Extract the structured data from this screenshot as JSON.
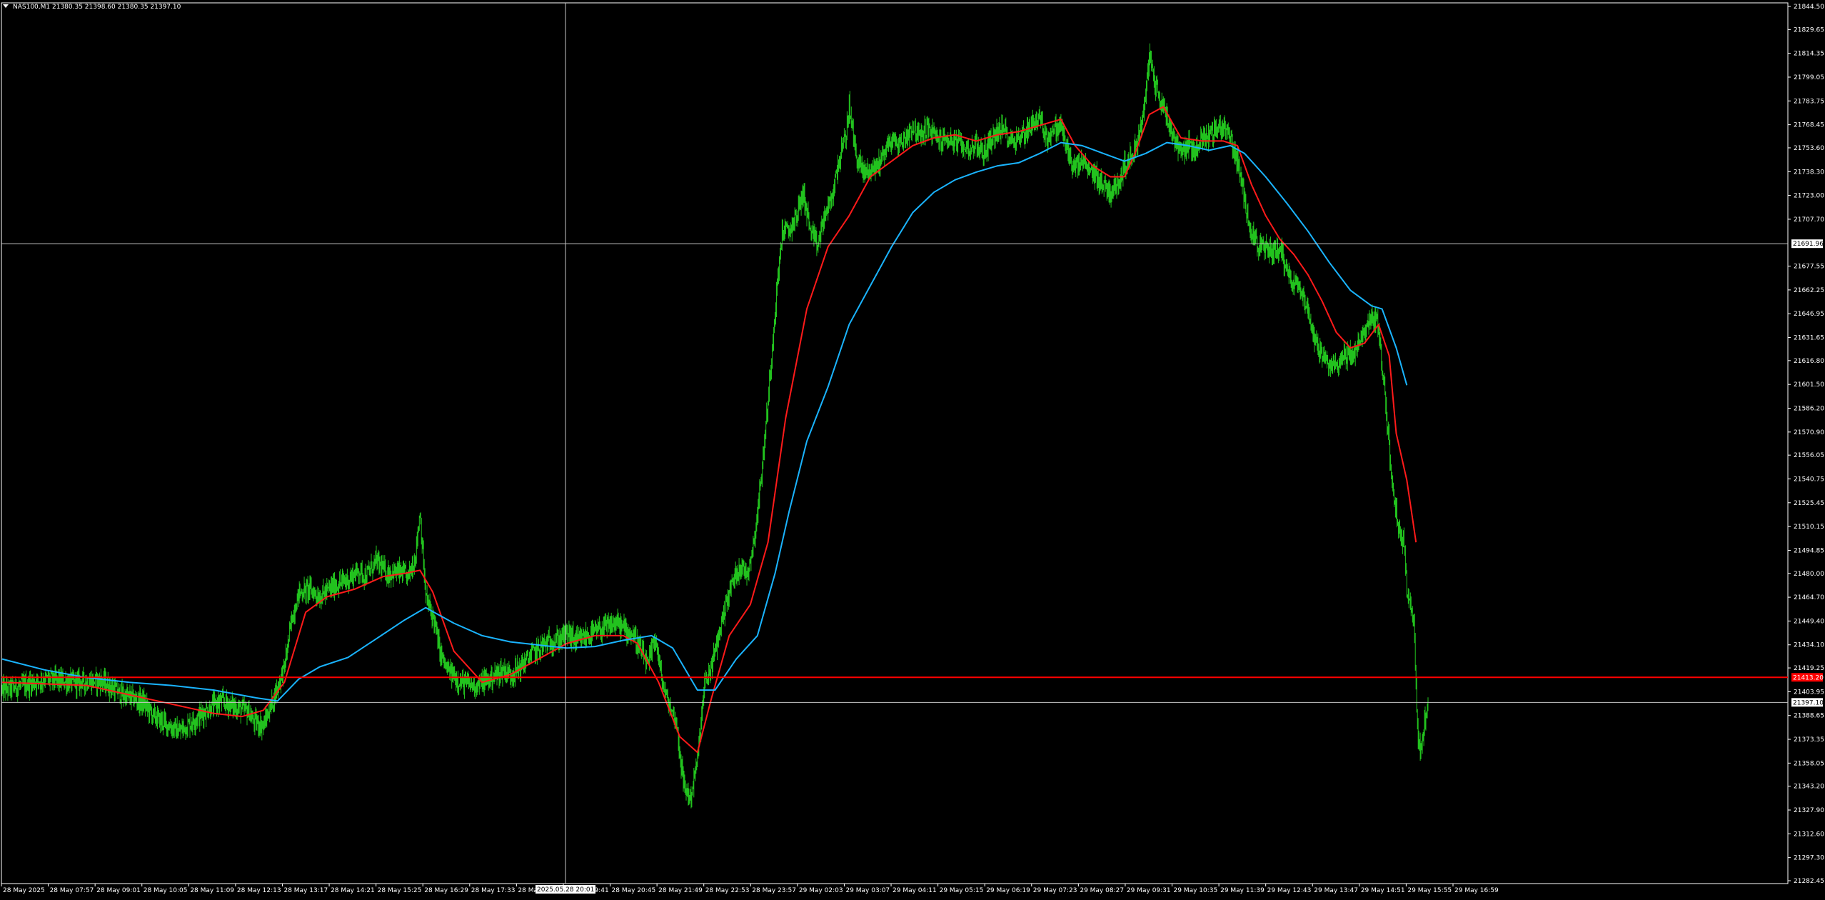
{
  "window": {
    "symbol_info": "NAS100,M1  21380.35 21398.60 21380.35 21397.10"
  },
  "colors": {
    "background": "#000000",
    "frame": "#ffffff",
    "axis_text": "#ffffff",
    "candles": "#22c21e",
    "wick": "#22c21e",
    "ma_fast": "#ff1a1a",
    "ma_slow": "#1ab4ff",
    "crosshair": "#c8c8c8",
    "hline_red": "#ff0000",
    "bid_line": "#c8c8c8"
  },
  "crosshair": {
    "price_label": "21691.96",
    "time_label": "2025.05.28 20:01"
  },
  "markers": {
    "red_line_label": "21413.20",
    "bid_label": "21397.10"
  },
  "chart_data": {
    "type": "line",
    "title": "NAS100,M1",
    "xlabel": "",
    "ylabel": "",
    "ylim": [
      21282.45,
      21844.5
    ],
    "grid": false,
    "y_ticks": [
      "21844.50",
      "21829.65",
      "21814.35",
      "21799.05",
      "21783.75",
      "21768.45",
      "21753.60",
      "21738.30",
      "21723.00",
      "21707.70",
      "21677.55",
      "21662.25",
      "21646.95",
      "21631.65",
      "21616.80",
      "21601.50",
      "21586.20",
      "21570.90",
      "21556.05",
      "21540.75",
      "21525.45",
      "21510.15",
      "21494.85",
      "21480.00",
      "21464.70",
      "21449.40",
      "21434.10",
      "21419.25",
      "21403.95",
      "21388.65",
      "21373.35",
      "21358.05",
      "21343.20",
      "21327.90",
      "21312.60",
      "21297.30",
      "21282.45"
    ],
    "x_ticks": [
      "28 May 2025",
      "28 May 07:57",
      "28 May 09:01",
      "28 May 10:05",
      "28 May 11:09",
      "28 May 12:13",
      "28 May 13:17",
      "28 May 14:21",
      "28 May 15:25",
      "28 May 16:29",
      "28 May 17:33",
      "28 May 18:37",
      "28 May 19:41",
      "28 May 20:45",
      "28 May 21:49",
      "28 May 22:53",
      "28 May 23:57",
      "29 May 02:03",
      "29 May 03:07",
      "29 May 04:11",
      "29 May 05:15",
      "29 May 06:19",
      "29 May 07:23",
      "29 May 08:27",
      "29 May 09:31",
      "29 May 10:35",
      "29 May 11:39",
      "29 May 12:43",
      "29 May 13:47",
      "29 May 14:51",
      "29 May 15:55",
      "29 May 16:59"
    ],
    "price_path": [
      [
        0,
        21405
      ],
      [
        30,
        21408
      ],
      [
        60,
        21412
      ],
      [
        100,
        21410
      ],
      [
        140,
        21411
      ],
      [
        170,
        21402
      ],
      [
        200,
        21397
      ],
      [
        215,
        21388
      ],
      [
        230,
        21384
      ],
      [
        250,
        21378
      ],
      [
        270,
        21385
      ],
      [
        290,
        21392
      ],
      [
        310,
        21398
      ],
      [
        330,
        21394
      ],
      [
        350,
        21391
      ],
      [
        355,
        21385
      ],
      [
        370,
        21382
      ],
      [
        385,
        21400
      ],
      [
        400,
        21420
      ],
      [
        410,
        21450
      ],
      [
        420,
        21467
      ],
      [
        435,
        21470
      ],
      [
        450,
        21465
      ],
      [
        470,
        21472
      ],
      [
        490,
        21476
      ],
      [
        505,
        21482
      ],
      [
        515,
        21478
      ],
      [
        530,
        21488
      ],
      [
        545,
        21480
      ],
      [
        560,
        21481
      ],
      [
        575,
        21478
      ],
      [
        585,
        21490
      ],
      [
        592,
        21520
      ],
      [
        600,
        21465
      ],
      [
        612,
        21450
      ],
      [
        620,
        21430
      ],
      [
        630,
        21418
      ],
      [
        650,
        21410
      ],
      [
        670,
        21408
      ],
      [
        690,
        21412
      ],
      [
        710,
        21418
      ],
      [
        720,
        21415
      ],
      [
        735,
        21420
      ],
      [
        750,
        21428
      ],
      [
        770,
        21435
      ],
      [
        790,
        21438
      ],
      [
        800,
        21442
      ],
      [
        815,
        21436
      ],
      [
        830,
        21440
      ],
      [
        850,
        21444
      ],
      [
        870,
        21448
      ],
      [
        880,
        21445
      ],
      [
        895,
        21440
      ],
      [
        905,
        21430
      ],
      [
        915,
        21420
      ],
      [
        925,
        21440
      ],
      [
        935,
        21410
      ],
      [
        945,
        21395
      ],
      [
        955,
        21385
      ],
      [
        965,
        21345
      ],
      [
        975,
        21335
      ],
      [
        985,
        21360
      ],
      [
        995,
        21408
      ],
      [
        1005,
        21420
      ],
      [
        1015,
        21440
      ],
      [
        1025,
        21460
      ],
      [
        1035,
        21475
      ],
      [
        1045,
        21485
      ],
      [
        1055,
        21480
      ],
      [
        1065,
        21500
      ],
      [
        1075,
        21540
      ],
      [
        1085,
        21590
      ],
      [
        1095,
        21650
      ],
      [
        1105,
        21700
      ],
      [
        1115,
        21700
      ],
      [
        1125,
        21710
      ],
      [
        1135,
        21725
      ],
      [
        1145,
        21700
      ],
      [
        1155,
        21690
      ],
      [
        1165,
        21710
      ],
      [
        1175,
        21720
      ],
      [
        1185,
        21745
      ],
      [
        1195,
        21760
      ],
      [
        1200,
        21780
      ],
      [
        1210,
        21748
      ],
      [
        1220,
        21738
      ],
      [
        1230,
        21740
      ],
      [
        1240,
        21742
      ],
      [
        1250,
        21752
      ],
      [
        1260,
        21758
      ],
      [
        1270,
        21756
      ],
      [
        1280,
        21760
      ],
      [
        1290,
        21768
      ],
      [
        1300,
        21760
      ],
      [
        1310,
        21767
      ],
      [
        1320,
        21762
      ],
      [
        1330,
        21758
      ],
      [
        1340,
        21760
      ],
      [
        1350,
        21757
      ],
      [
        1360,
        21755
      ],
      [
        1370,
        21753
      ],
      [
        1380,
        21756
      ],
      [
        1390,
        21750
      ],
      [
        1400,
        21758
      ],
      [
        1410,
        21764
      ],
      [
        1420,
        21765
      ],
      [
        1430,
        21758
      ],
      [
        1440,
        21760
      ],
      [
        1450,
        21764
      ],
      [
        1460,
        21770
      ],
      [
        1470,
        21772
      ],
      [
        1480,
        21760
      ],
      [
        1490,
        21765
      ],
      [
        1500,
        21768
      ],
      [
        1510,
        21750
      ],
      [
        1520,
        21740
      ],
      [
        1530,
        21745
      ],
      [
        1540,
        21738
      ],
      [
        1550,
        21736
      ],
      [
        1560,
        21730
      ],
      [
        1570,
        21725
      ],
      [
        1580,
        21730
      ],
      [
        1590,
        21742
      ],
      [
        1600,
        21748
      ],
      [
        1610,
        21760
      ],
      [
        1620,
        21785
      ],
      [
        1625,
        21815
      ],
      [
        1630,
        21800
      ],
      [
        1640,
        21785
      ],
      [
        1650,
        21775
      ],
      [
        1660,
        21760
      ],
      [
        1670,
        21752
      ],
      [
        1680,
        21755
      ],
      [
        1690,
        21752
      ],
      [
        1700,
        21760
      ],
      [
        1710,
        21762
      ],
      [
        1720,
        21765
      ],
      [
        1730,
        21768
      ],
      [
        1740,
        21760
      ],
      [
        1750,
        21745
      ],
      [
        1760,
        21720
      ],
      [
        1770,
        21700
      ],
      [
        1780,
        21690
      ],
      [
        1790,
        21688
      ],
      [
        1800,
        21687
      ],
      [
        1810,
        21690
      ],
      [
        1820,
        21675
      ],
      [
        1830,
        21667
      ],
      [
        1840,
        21665
      ],
      [
        1850,
        21648
      ],
      [
        1860,
        21630
      ],
      [
        1870,
        21620
      ],
      [
        1880,
        21612
      ],
      [
        1890,
        21615
      ],
      [
        1900,
        21620
      ],
      [
        1910,
        21620
      ],
      [
        1920,
        21625
      ],
      [
        1930,
        21635
      ],
      [
        1940,
        21645
      ],
      [
        1950,
        21640
      ],
      [
        1955,
        21610
      ],
      [
        1960,
        21590
      ],
      [
        1965,
        21560
      ],
      [
        1970,
        21535
      ],
      [
        1975,
        21520
      ],
      [
        1980,
        21505
      ],
      [
        1985,
        21500
      ],
      [
        1990,
        21470
      ],
      [
        1995,
        21465
      ],
      [
        2000,
        21450
      ],
      [
        2003,
        21410
      ],
      [
        2006,
        21370
      ],
      [
        2010,
        21365
      ],
      [
        2015,
        21385
      ],
      [
        2020,
        21397
      ]
    ],
    "series": [
      {
        "values": [
          [
            0,
            21410
          ],
          [
            60,
            21409
          ],
          [
            120,
            21408
          ],
          [
            180,
            21402
          ],
          [
            240,
            21396
          ],
          [
            300,
            21390
          ],
          [
            340,
            21388
          ],
          [
            370,
            21392
          ],
          [
            400,
            21410
          ],
          [
            430,
            21455
          ],
          [
            460,
            21465
          ],
          [
            500,
            21470
          ],
          [
            540,
            21478
          ],
          [
            570,
            21480
          ],
          [
            592,
            21482
          ],
          [
            610,
            21468
          ],
          [
            640,
            21430
          ],
          [
            680,
            21410
          ],
          [
            720,
            21415
          ],
          [
            760,
            21425
          ],
          [
            800,
            21435
          ],
          [
            840,
            21440
          ],
          [
            880,
            21440
          ],
          [
            900,
            21435
          ],
          [
            930,
            21410
          ],
          [
            960,
            21375
          ],
          [
            985,
            21365
          ],
          [
            1005,
            21400
          ],
          [
            1030,
            21440
          ],
          [
            1060,
            21460
          ],
          [
            1085,
            21500
          ],
          [
            1110,
            21580
          ],
          [
            1140,
            21650
          ],
          [
            1170,
            21690
          ],
          [
            1200,
            21710
          ],
          [
            1230,
            21735
          ],
          [
            1260,
            21745
          ],
          [
            1290,
            21755
          ],
          [
            1320,
            21760
          ],
          [
            1350,
            21762
          ],
          [
            1380,
            21758
          ],
          [
            1410,
            21762
          ],
          [
            1440,
            21764
          ],
          [
            1470,
            21768
          ],
          [
            1500,
            21772
          ],
          [
            1520,
            21755
          ],
          [
            1545,
            21742
          ],
          [
            1570,
            21735
          ],
          [
            1590,
            21735
          ],
          [
            1605,
            21750
          ],
          [
            1625,
            21775
          ],
          [
            1645,
            21780
          ],
          [
            1670,
            21760
          ],
          [
            1700,
            21758
          ],
          [
            1730,
            21758
          ],
          [
            1750,
            21755
          ],
          [
            1770,
            21730
          ],
          [
            1790,
            21710
          ],
          [
            1810,
            21695
          ],
          [
            1830,
            21685
          ],
          [
            1850,
            21672
          ],
          [
            1870,
            21655
          ],
          [
            1890,
            21635
          ],
          [
            1910,
            21625
          ],
          [
            1930,
            21628
          ],
          [
            1950,
            21640
          ],
          [
            1965,
            21620
          ],
          [
            1975,
            21570
          ],
          [
            1990,
            21540
          ],
          [
            2003,
            21500
          ]
        ]
      },
      {
        "values": [
          [
            0,
            21425
          ],
          [
            60,
            21418
          ],
          [
            120,
            21413
          ],
          [
            180,
            21410
          ],
          [
            240,
            21408
          ],
          [
            300,
            21405
          ],
          [
            360,
            21400
          ],
          [
            390,
            21398
          ],
          [
            420,
            21412
          ],
          [
            450,
            21420
          ],
          [
            490,
            21426
          ],
          [
            530,
            21438
          ],
          [
            570,
            21450
          ],
          [
            600,
            21458
          ],
          [
            640,
            21448
          ],
          [
            680,
            21440
          ],
          [
            720,
            21436
          ],
          [
            760,
            21434
          ],
          [
            800,
            21432
          ],
          [
            840,
            21433
          ],
          [
            880,
            21437
          ],
          [
            920,
            21440
          ],
          [
            950,
            21432
          ],
          [
            985,
            21405
          ],
          [
            1010,
            21405
          ],
          [
            1040,
            21425
          ],
          [
            1070,
            21440
          ],
          [
            1095,
            21480
          ],
          [
            1115,
            21520
          ],
          [
            1140,
            21565
          ],
          [
            1170,
            21600
          ],
          [
            1200,
            21640
          ],
          [
            1230,
            21665
          ],
          [
            1260,
            21690
          ],
          [
            1290,
            21712
          ],
          [
            1320,
            21725
          ],
          [
            1350,
            21733
          ],
          [
            1380,
            21738
          ],
          [
            1410,
            21742
          ],
          [
            1440,
            21744
          ],
          [
            1470,
            21750
          ],
          [
            1500,
            21757
          ],
          [
            1530,
            21755
          ],
          [
            1560,
            21750
          ],
          [
            1590,
            21745
          ],
          [
            1620,
            21750
          ],
          [
            1650,
            21757
          ],
          [
            1680,
            21755
          ],
          [
            1710,
            21752
          ],
          [
            1740,
            21755
          ],
          [
            1760,
            21750
          ],
          [
            1790,
            21735
          ],
          [
            1820,
            21718
          ],
          [
            1850,
            21700
          ],
          [
            1880,
            21680
          ],
          [
            1910,
            21662
          ],
          [
            1940,
            21652
          ],
          [
            1955,
            21650
          ],
          [
            1975,
            21625
          ],
          [
            1990,
            21601
          ]
        ]
      }
    ],
    "horizontal_lines": [
      21413.2,
      21397.1
    ],
    "crosshair_value": 21691.96
  }
}
